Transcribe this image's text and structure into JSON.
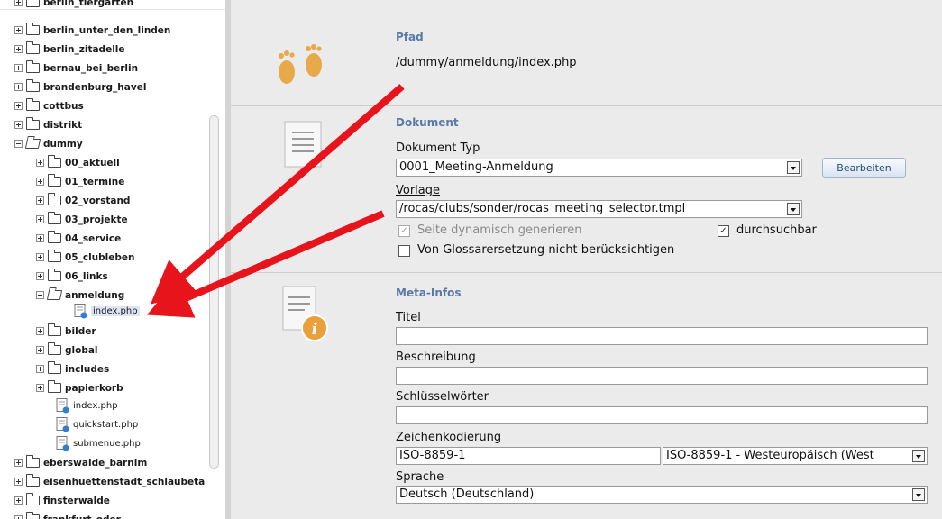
{
  "tree": {
    "items": [
      {
        "label": "berlin_tiergarten"
      },
      {
        "label": "berlin_unter_den_linden"
      },
      {
        "label": "berlin_zitadelle"
      },
      {
        "label": "bernau_bei_berlin"
      },
      {
        "label": "brandenburg_havel"
      },
      {
        "label": "cottbus"
      },
      {
        "label": "distrikt"
      },
      {
        "label": "dummy"
      },
      {
        "label": "00_aktuell"
      },
      {
        "label": "01_termine"
      },
      {
        "label": "02_vorstand"
      },
      {
        "label": "03_projekte"
      },
      {
        "label": "04_service"
      },
      {
        "label": "05_clubleben"
      },
      {
        "label": "06_links"
      },
      {
        "label": "anmeldung"
      },
      {
        "label": "index.php"
      },
      {
        "label": "bilder"
      },
      {
        "label": "global"
      },
      {
        "label": "includes"
      },
      {
        "label": "papierkorb"
      },
      {
        "label": "index.php"
      },
      {
        "label": "quickstart.php"
      },
      {
        "label": "submenue.php"
      },
      {
        "label": "eberswalde_barnim"
      },
      {
        "label": "eisenhuettenstadt_schlaubeta"
      },
      {
        "label": "finsterwalde"
      },
      {
        "label": "frankfurt_oder"
      }
    ]
  },
  "pfad": {
    "heading": "Pfad",
    "value": "/dummy/anmeldung/index.php"
  },
  "dokument": {
    "heading": "Dokument",
    "typ_label": "Dokument Typ",
    "typ_value": "0001_Meeting-Anmeldung",
    "edit_button": "Bearbeiten",
    "vorlage_label": "Vorlage",
    "vorlage_value": "/rocas/clubs/sonder/rocas_meeting_selector.tmpl",
    "dynamic_label": "Seite dynamisch generieren",
    "searchable_label": "durchsuchbar",
    "glossary_label": "Von Glossarersetzung nicht berücksichtigen"
  },
  "meta": {
    "heading": "Meta-Infos",
    "titel_label": "Titel",
    "titel_value": "",
    "beschreibung_label": "Beschreibung",
    "beschreibung_value": "",
    "keywords_label": "Schlüsselwörter",
    "keywords_value": "",
    "encoding_label": "Zeichenkodierung",
    "encoding_value": "ISO-8859-1",
    "encoding_select": "ISO-8859-1 - Westeuropäisch (West",
    "sprache_label": "Sprache",
    "sprache_value": "Deutsch (Deutschland)"
  },
  "colors": {
    "section_heading": "#5a7aa5",
    "panel_bg": "#ebebeb",
    "arrow": "#e8141c",
    "selection": "#dde4f4"
  }
}
